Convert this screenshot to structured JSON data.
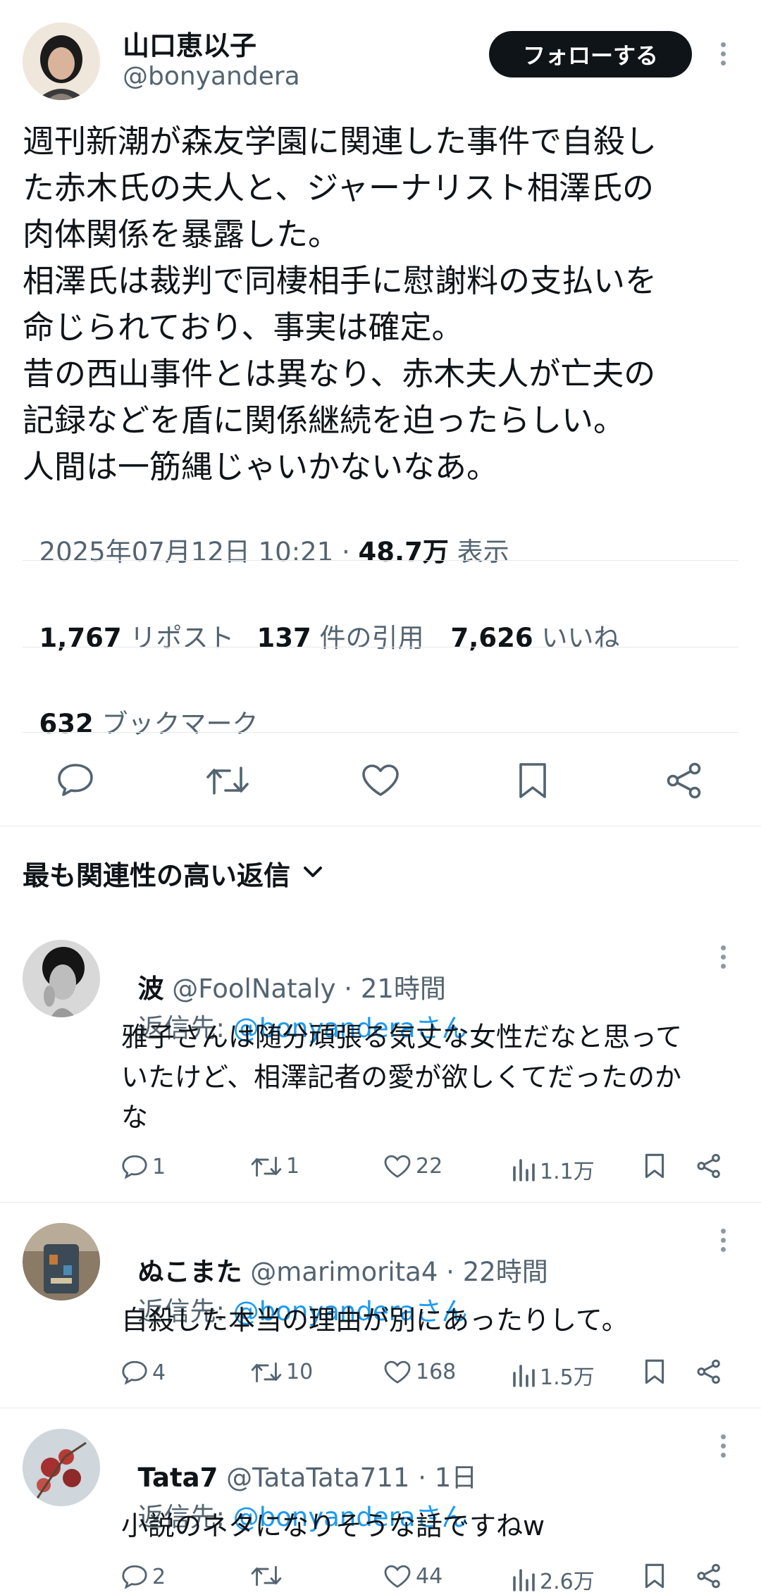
{
  "author": {
    "display_name": "山口恵以子",
    "handle": "@bonyandera",
    "follow_label": "フォローする"
  },
  "tweet": {
    "text": "週刊新潮が森友学園に関連した事件で自殺し\nた赤木氏の夫人と、ジャーナリスト相澤氏の\n肉体関係を暴露した。\n相澤氏は裁判で同棲相手に慰謝料の支払いを\n命じられており、事実は確定。\n昔の西山事件とは異なり、赤木夫人が亡夫の\n記録などを盾に関係継続を迫ったらしい。\n人間は一筋縄じゃいかないなあ。",
    "timestamp": "2025年07月12日 10:21 · ",
    "views_count": "48.7万",
    "views_label": " 表示"
  },
  "stats": {
    "reposts_count": "1,767",
    "reposts_label": "リポスト",
    "quotes_count": "137",
    "quotes_label": "件の引用",
    "likes_count": "7,626",
    "likes_label": "いいね",
    "bookmarks_count": "632",
    "bookmarks_label": "ブックマーク"
  },
  "replies_header": {
    "label": "最も関連性の高い返信"
  },
  "replies": [
    {
      "display_name": "波",
      "handle": "@FoolNataly",
      "time": "· 21時間",
      "reply_to_prefix": "返信先: ",
      "reply_to": "@bonyanderaさん",
      "text": "雅子さんは随分頑張る気丈な女性だなと思って\nいたけど、相澤記者の愛が欲しくてだったのか\nな",
      "replies": "1",
      "reposts": "1",
      "likes": "22",
      "views": "1.1万"
    },
    {
      "display_name": "ぬこまた",
      "handle": "@marimorita4",
      "time": "· 22時間",
      "reply_to_prefix": "返信先: ",
      "reply_to": "@bonyanderaさん",
      "text": "自殺した本当の理由が別にあったりして。",
      "replies": "4",
      "reposts": "10",
      "likes": "168",
      "views": "1.5万"
    },
    {
      "display_name": "Tata7",
      "handle": "@TataTata711",
      "time": "· 1日",
      "reply_to_prefix": "返信先: ",
      "reply_to": "@bonyanderaさん",
      "text": "小説のネタになりそうな話ですねw",
      "replies": "2",
      "reposts": "",
      "likes": "44",
      "views": "2.6万"
    }
  ],
  "colors": {
    "text": "#0f1419",
    "secondary": "#536471",
    "link": "#1d9bf0",
    "divider": "#e6e9ec"
  }
}
